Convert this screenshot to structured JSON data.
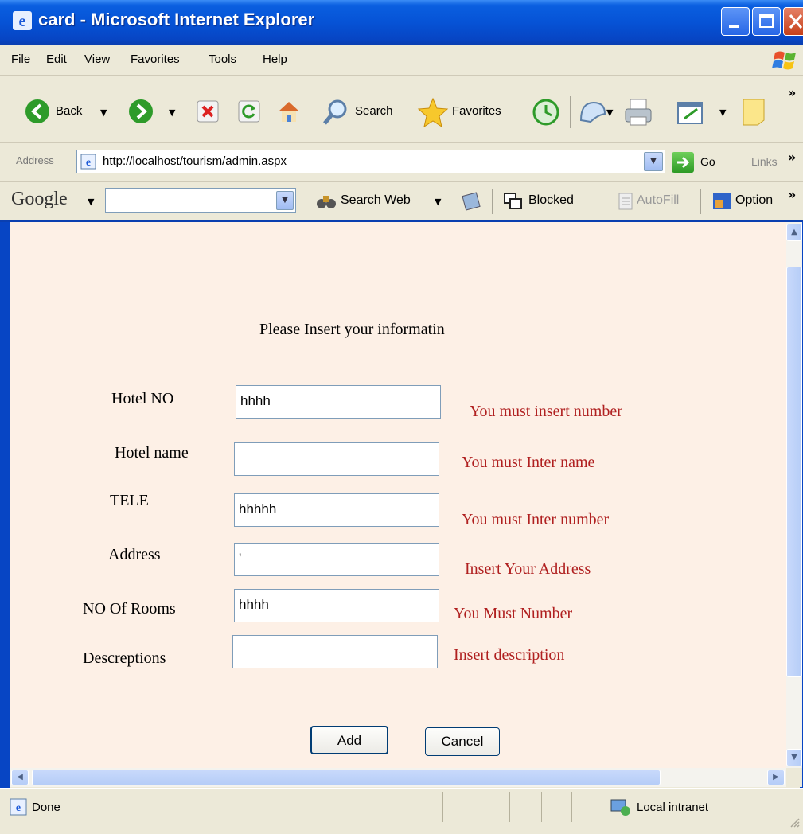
{
  "window": {
    "title": "card - Microsoft Internet Explorer"
  },
  "menubar": {
    "items": [
      "File",
      "Edit",
      "View",
      "Favorites",
      "Tools",
      "Help"
    ]
  },
  "toolbar": {
    "back_label": "Back",
    "search_label": "Search",
    "favorites_label": "Favorites"
  },
  "address": {
    "label": "Address",
    "url": "http://localhost/tourism/admin.aspx",
    "go_label": "Go",
    "links_label": "Links"
  },
  "googlebar": {
    "logo": "Google",
    "search_value": "",
    "search_web_label": "Search Web",
    "blocked_label": "Blocked",
    "autofill_label": "AutoFill",
    "options_label": "Option"
  },
  "form": {
    "heading": "Please Insert your informatin",
    "fields": [
      {
        "label": "Hotel NO",
        "value": "hhhh",
        "error": "You must insert number"
      },
      {
        "label": "Hotel name",
        "value": "",
        "error": "You must Inter name"
      },
      {
        "label": "TELE",
        "value": "hhhhh",
        "error": "You must Inter number"
      },
      {
        "label": "Address",
        "value": "'",
        "error": "Insert Your Address"
      },
      {
        "label": "NO Of Rooms",
        "value": "hhhh",
        "error": "You Must Number"
      },
      {
        "label": "Descreptions",
        "value": "",
        "error": "Insert description"
      }
    ],
    "add_label": "Add",
    "cancel_label": "Cancel"
  },
  "status": {
    "text": "Done",
    "zone": "Local intranet"
  },
  "colors": {
    "titlebar": "#0653d6",
    "content_bg": "#fdf0e6",
    "error_text": "#b02020"
  }
}
